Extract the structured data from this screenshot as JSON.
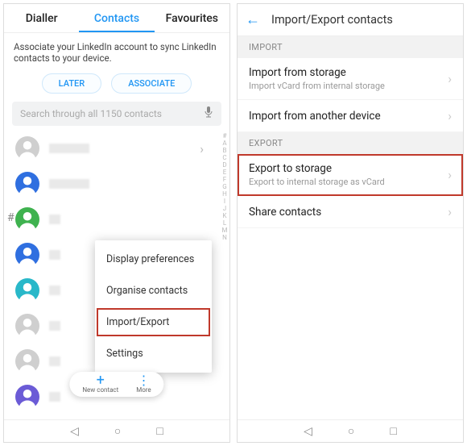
{
  "left": {
    "tabs": {
      "dialler": "Dialler",
      "contacts": "Contacts",
      "favourites": "Favourites"
    },
    "linkedin_text": "Associate your LinkedIn account to sync LinkedIn contacts to your device.",
    "later": "LATER",
    "associate": "ASSOCIATE",
    "search_placeholder": "Search through all 1150 contacts",
    "index": "#ABCDEFGHIJKLMN",
    "section_marker": "#",
    "popup": {
      "display_prefs": "Display preferences",
      "organise": "Organise contacts",
      "import_export": "Import/Export",
      "settings": "Settings"
    },
    "fab": {
      "new_label": "New contact",
      "more_label": "More"
    },
    "contacts": [
      {
        "color": "#cfcfcf"
      },
      {
        "color": "#2f6fe0"
      },
      {
        "color": "#3fb24f"
      },
      {
        "color": "#2f6fe0"
      },
      {
        "color": "#29b8c9"
      },
      {
        "color": "#cfcfcf"
      },
      {
        "color": "#cfcfcf"
      },
      {
        "color": "#6b5bd6"
      }
    ]
  },
  "right": {
    "title": "Import/Export contacts",
    "sect_import": "IMPORT",
    "imp_storage": "Import from storage",
    "imp_storage_sub": "Import vCard from internal storage",
    "imp_device": "Import from another device",
    "sect_export": "EXPORT",
    "exp_storage": "Export to storage",
    "exp_storage_sub": "Export to internal storage as vCard",
    "share": "Share contacts"
  }
}
